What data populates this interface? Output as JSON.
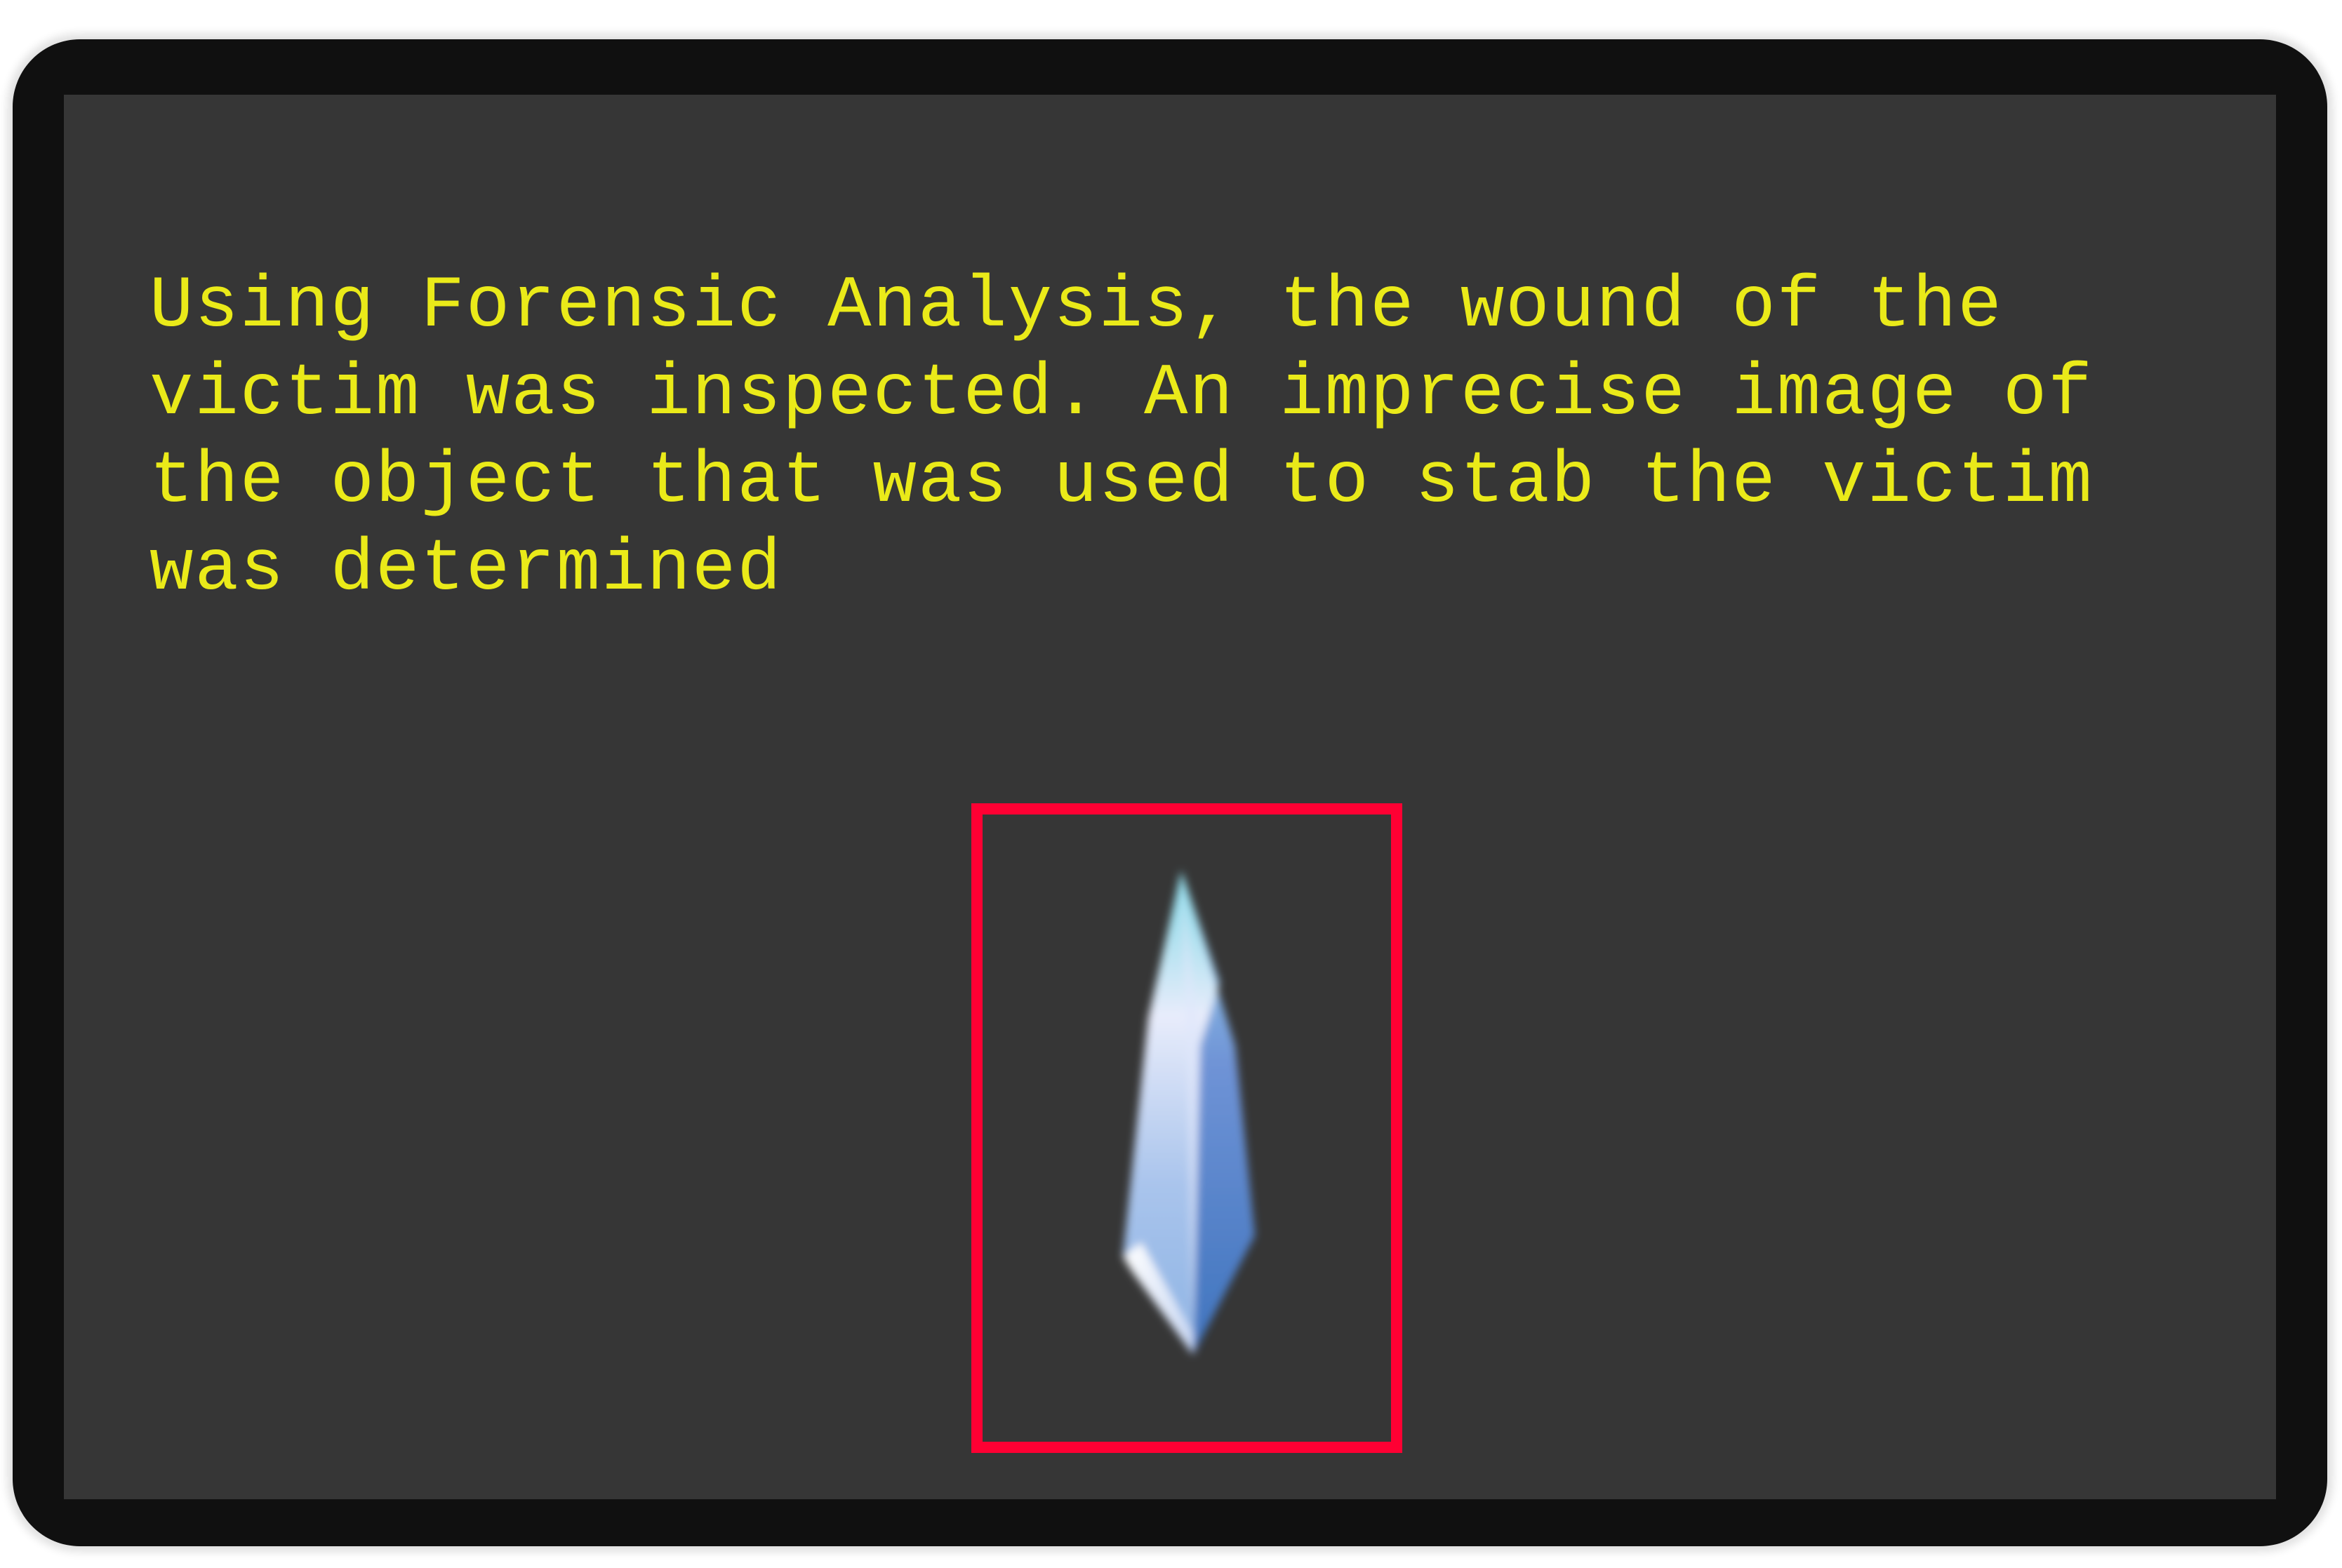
{
  "dialog": {
    "text": "Using Forensic Analysis, the wound of the victim was inspected. An imprecise image of the object that was used to stab the victim was determined"
  },
  "evidence": {
    "icon": "crystal-shard-icon",
    "frame_color": "#ff0033"
  },
  "colors": {
    "text": "#eaea19",
    "screen": "#363636",
    "bezel": "#101010"
  }
}
